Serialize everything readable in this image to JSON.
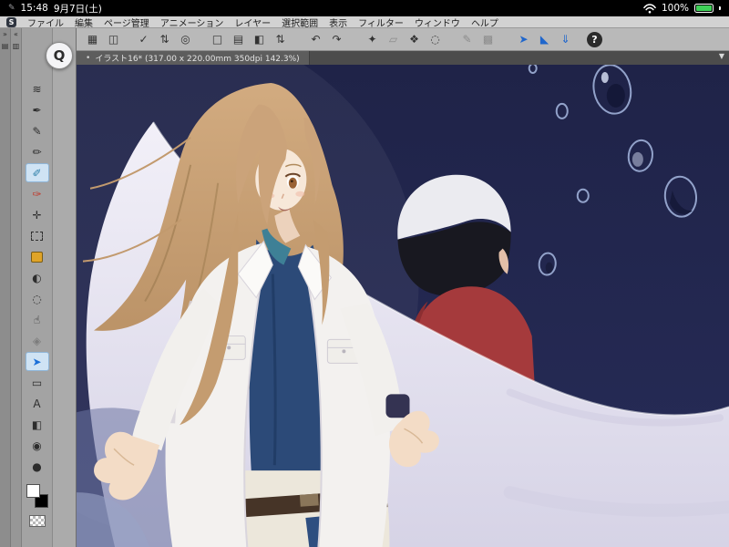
{
  "status_bar": {
    "status_icon": "✎",
    "time": "15:48",
    "date": "9月7日(土)",
    "battery_percent": "100%"
  },
  "menu_bar": {
    "logo_letter": "S",
    "items": [
      "ファイル",
      "編集",
      "ページ管理",
      "アニメーション",
      "レイヤー",
      "選択範囲",
      "表示",
      "フィルター",
      "ウィンドウ",
      "ヘルプ"
    ]
  },
  "command_bar": {
    "buttons": [
      {
        "name": "workspace-layout",
        "glyph": "▦"
      },
      {
        "name": "flip-view",
        "glyph": "◫"
      },
      {
        "name": "snap-check",
        "glyph": "✓"
      },
      {
        "name": "snap-stepper",
        "glyph": "⇅"
      },
      {
        "name": "symmetry-ruler",
        "glyph": "◎"
      },
      {
        "name": "new-page",
        "glyph": "□"
      },
      {
        "name": "open-page",
        "glyph": "▤"
      },
      {
        "name": "export-page",
        "glyph": "◧"
      },
      {
        "name": "page-stepper",
        "glyph": "⇅"
      },
      {
        "name": "undo",
        "glyph": "↶"
      },
      {
        "name": "redo",
        "glyph": "↷"
      },
      {
        "name": "auto-select",
        "glyph": "✦"
      },
      {
        "name": "transform",
        "glyph": "▱"
      },
      {
        "name": "fill-tool",
        "glyph": "❖"
      },
      {
        "name": "select-area",
        "glyph": "◌"
      },
      {
        "name": "correct-line",
        "glyph": "✎"
      },
      {
        "name": "pixel-grid",
        "glyph": "▩"
      },
      {
        "name": "object-cursor",
        "glyph": "➤"
      },
      {
        "name": "ruler-snap",
        "glyph": "◣"
      },
      {
        "name": "import",
        "glyph": "⇓"
      },
      {
        "name": "help",
        "glyph": "?"
      }
    ]
  },
  "tab_bar": {
    "modified_indicator": "•",
    "title": "イラスト16* (317.00 x 220.00mm 350dpi 142.3%)",
    "dropdown_glyph": "▼"
  },
  "dock": {
    "expand_glyph": "»",
    "collapse_glyph": "«",
    "palette_tabs_glyph": "▤",
    "palette_list_glyph": "▥"
  },
  "tools": {
    "quick_access_label": "Q",
    "items": [
      {
        "name": "layer-move",
        "glyph": "≋"
      },
      {
        "name": "selection-pen",
        "glyph": "✒"
      },
      {
        "name": "pen",
        "glyph": "✎"
      },
      {
        "name": "pencil",
        "glyph": "✏"
      },
      {
        "name": "brush",
        "glyph": "✐",
        "selected": true,
        "color": "#2e7fa8"
      },
      {
        "name": "marker",
        "glyph": "✑",
        "color": "#c0392b"
      },
      {
        "name": "hand",
        "glyph": "✛"
      },
      {
        "name": "marquee",
        "glyph": ""
      },
      {
        "name": "bucket-fill",
        "glyph": "",
        "color": "#e0a428"
      },
      {
        "name": "gradient-circle",
        "glyph": "◐"
      },
      {
        "name": "blend",
        "glyph": "◌"
      },
      {
        "name": "finger-smudge",
        "glyph": "☝"
      },
      {
        "name": "frame",
        "glyph": "◈"
      },
      {
        "name": "object-arrow",
        "glyph": "➤",
        "selected": true,
        "color": "#1b6fd8"
      },
      {
        "name": "figure",
        "glyph": "▭"
      },
      {
        "name": "text",
        "glyph": "A"
      },
      {
        "name": "gradient",
        "glyph": "◧"
      },
      {
        "name": "eyedropper",
        "glyph": "◉"
      },
      {
        "name": "ellipse",
        "glyph": "●"
      }
    ]
  },
  "swatches": {
    "main_color": "#ffffff",
    "sub_color": "#000000"
  },
  "canvas": {
    "colors": {
      "background": "#232850",
      "wing": "#e9e6f3",
      "hair": "#c9a279",
      "skin": "#f6e6d7",
      "shirt": "#2c4a78",
      "collar": "#3e8096",
      "jacket": "#f2f0ee",
      "red_garment": "#a53a3c",
      "white_hair": "#ebebf0",
      "black_hair": "#181820",
      "droplet_outline": "#9fb0d8",
      "belt": "#463427"
    }
  }
}
